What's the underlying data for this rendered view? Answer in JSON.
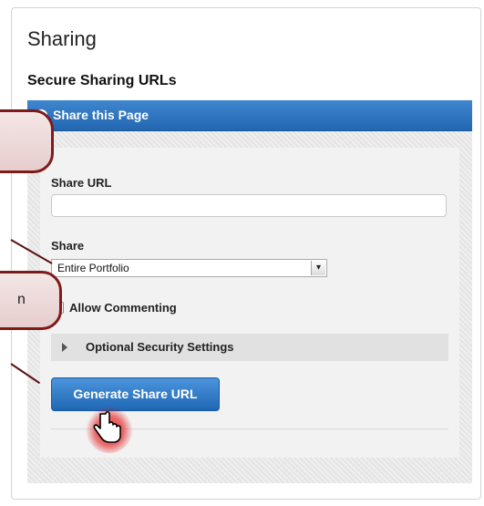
{
  "sharing": {
    "title": "Sharing",
    "subtitle": "Secure Sharing URLs",
    "accordion_label": "Share this Page",
    "share_url_label": "Share URL",
    "share_url_value": "",
    "share_label": "Share",
    "share_selected": "Entire Portfolio",
    "allow_commenting_label": "Allow Commenting",
    "allow_commenting_checked": false,
    "optional_security_label": "Optional Security Settings",
    "generate_button_label": "Generate Share URL"
  },
  "callouts": {
    "second_visible_text": "n"
  },
  "colors": {
    "accent_blue": "#2367b1",
    "callout_border": "#7d1b1b"
  },
  "icons": {
    "accordion": "plus-circle-icon",
    "select": "chevron-down-icon",
    "collapse": "triangle-right-icon",
    "cursor": "hand-pointer-icon"
  }
}
